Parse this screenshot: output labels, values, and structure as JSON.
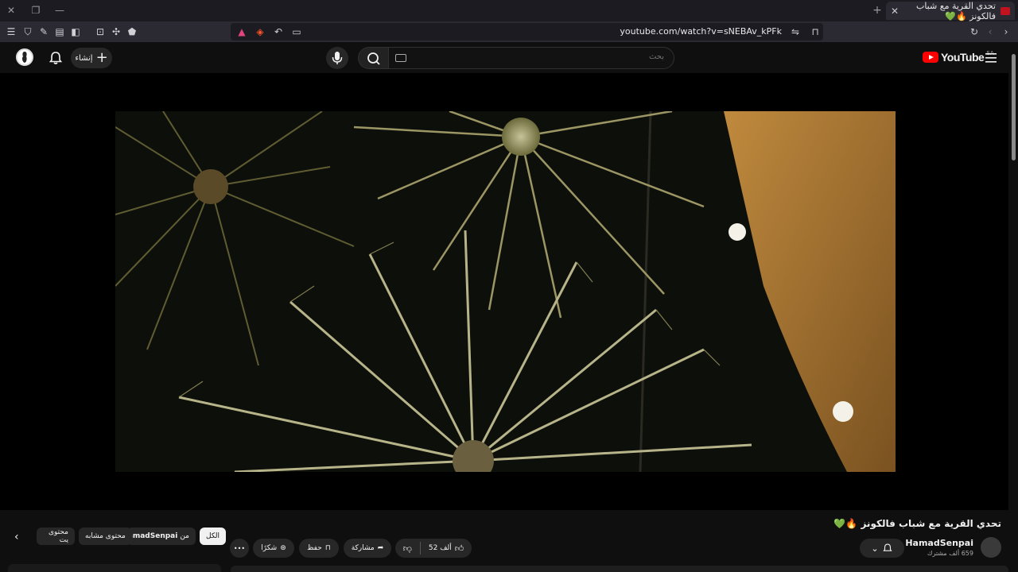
{
  "browser": {
    "tab_title": "تحدي القرية مع شباب فالكونز 🔥💚",
    "tab_close": "✕",
    "new_tab": "+",
    "url": "youtube.com/watch?v=sNEBAv_kPFk"
  },
  "youtube": {
    "logo_text": "YouTube",
    "region": "SA",
    "search_placeholder": "بحث",
    "create_label": "إنشاء"
  },
  "video": {
    "title": "تحدي القرية مع شباب فالكونز 🔥💚",
    "channel_name": "HamadSenpai",
    "subscribers": "659 ألف مشترك",
    "like_count": "52 ألف",
    "share_label": "مشاركة",
    "save_label": "حفظ",
    "thanks_label": "شكرًا",
    "more_label": "•••"
  },
  "chips": {
    "all": "الكل",
    "from_prefix": "من",
    "from_channel": "HamadSenpai",
    "related": "محتوى مشابه",
    "partial": "محتوى يت"
  },
  "colors": {
    "brand_red": "#ff0000",
    "page_bg": "#0f0f0f",
    "chrome_bg": "#2b2a33"
  }
}
